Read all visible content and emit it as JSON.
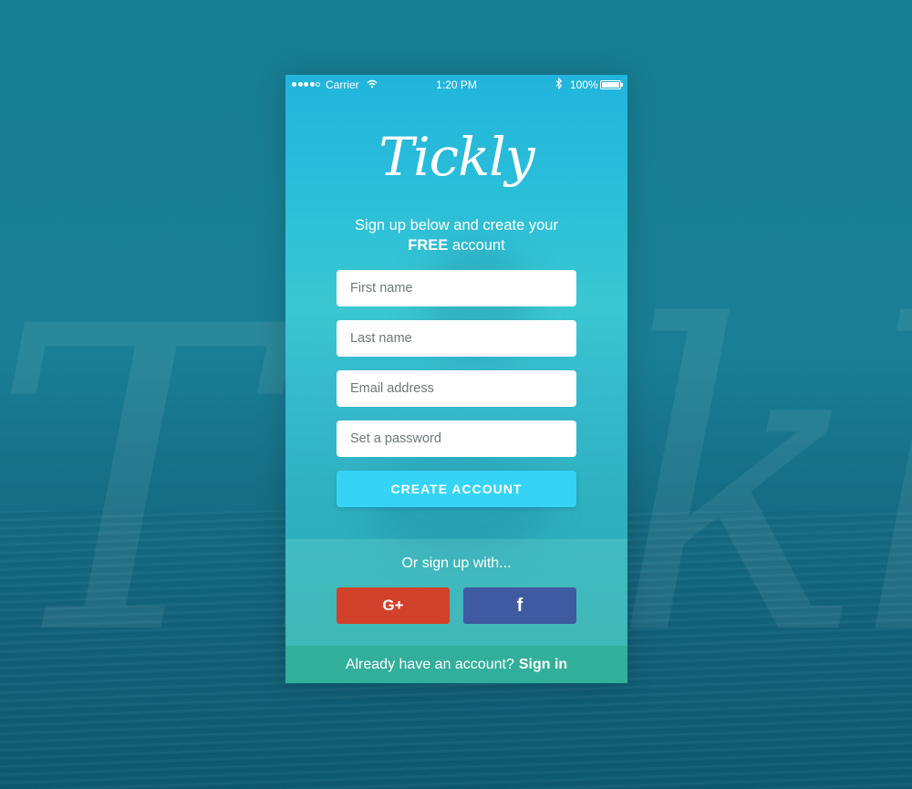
{
  "background": {
    "watermark": "Tickly"
  },
  "status_bar": {
    "carrier": "Carrier",
    "time": "1:20 PM",
    "battery": "100%"
  },
  "app": {
    "logo": "Tickly",
    "tagline_line1": "Sign up below and create your",
    "tagline_bold": "FREE",
    "tagline_rest": "account"
  },
  "form": {
    "first_name_placeholder": "First name",
    "last_name_placeholder": "Last name",
    "email_placeholder": "Email address",
    "password_placeholder": "Set a password",
    "submit_label": "CREATE ACCOUNT"
  },
  "social": {
    "label": "Or sign up with...",
    "google_glyph": "G+",
    "facebook_glyph": "f"
  },
  "footer": {
    "prompt": "Already have an account?",
    "link": "Sign in"
  },
  "colors": {
    "cta": "#35d4f7",
    "google": "#d2412b",
    "facebook": "#3f5aa0"
  },
  "icons": [
    "signal-dots-icon",
    "wifi-icon",
    "bluetooth-icon",
    "battery-icon",
    "google-plus-icon",
    "facebook-icon"
  ]
}
